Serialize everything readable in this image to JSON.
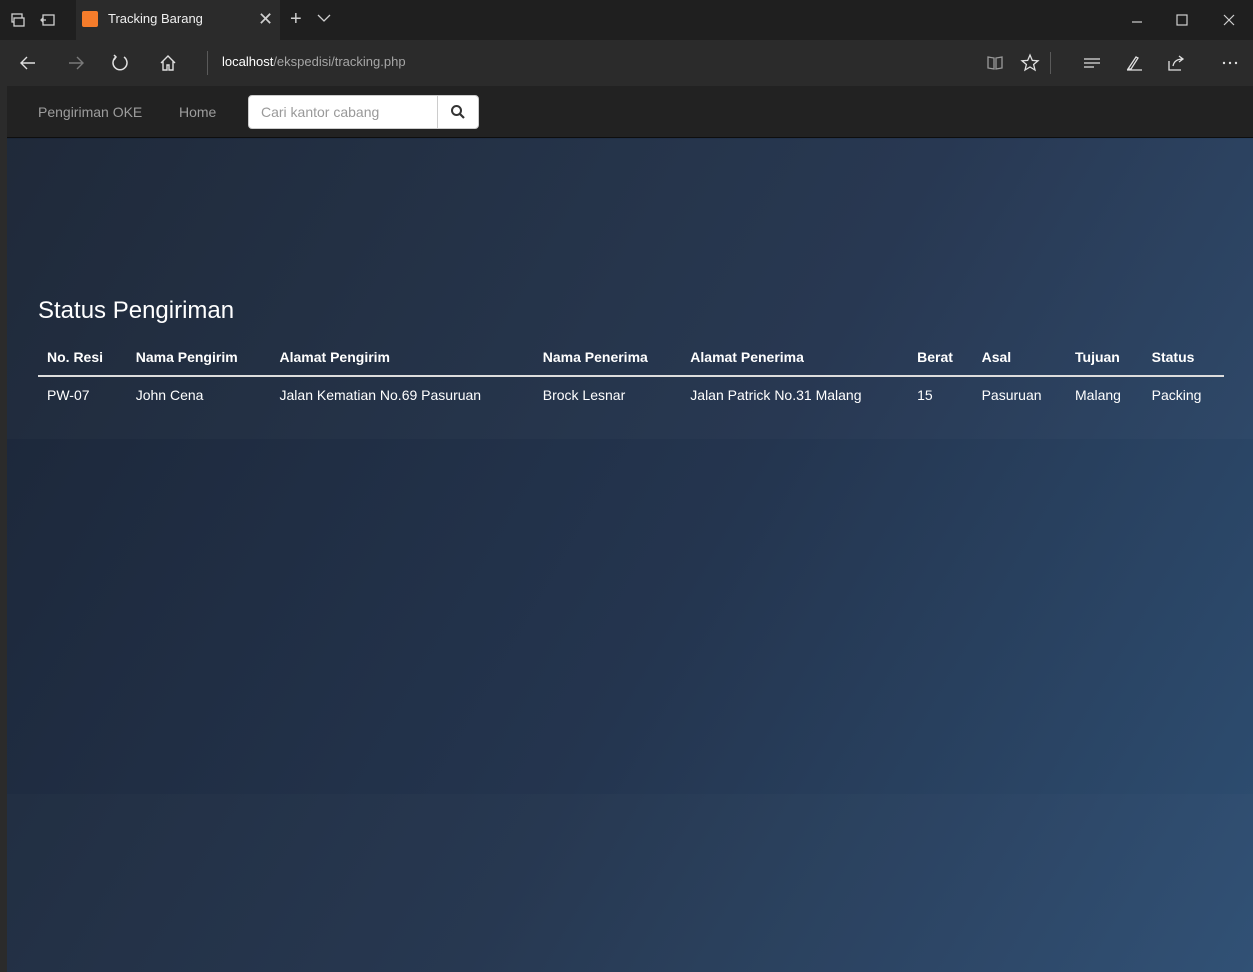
{
  "browser": {
    "tab_title": "Tracking Barang",
    "address_host": "localhost",
    "address_path": "/ekspedisi/tracking.php"
  },
  "site": {
    "brand": "Pengiriman OKE",
    "home_link": "Home",
    "search_placeholder": "Cari kantor cabang"
  },
  "main": {
    "title": "Status Pengiriman",
    "columns": [
      "No. Resi",
      "Nama Pengirim",
      "Alamat Pengirim",
      "Nama Penerima",
      "Alamat Penerima",
      "Berat",
      "Asal",
      "Tujuan",
      "Status"
    ],
    "rows": [
      [
        "PW-07",
        "John Cena",
        "Jalan Kematian No.69 Pasuruan",
        "Brock Lesnar",
        "Jalan Patrick No.31 Malang",
        "15",
        "Pasuruan",
        "Malang",
        "Packing"
      ]
    ]
  },
  "colors": {
    "favicon": "#f57c2b",
    "site_nav_bg": "#222222",
    "page_gradient_start": "#1b2536",
    "page_gradient_end": "#2e4f73"
  },
  "icons": [
    "tab-preview-icon",
    "tab-aside-icon",
    "close-icon",
    "plus-icon",
    "chevron-down-icon",
    "minimize-icon",
    "maximize-icon",
    "back-arrow-icon",
    "forward-arrow-icon",
    "refresh-icon",
    "home-icon",
    "reading-view-icon",
    "favorite-star-icon",
    "hub-icon",
    "pen-icon",
    "share-icon",
    "more-icon",
    "search-icon"
  ]
}
